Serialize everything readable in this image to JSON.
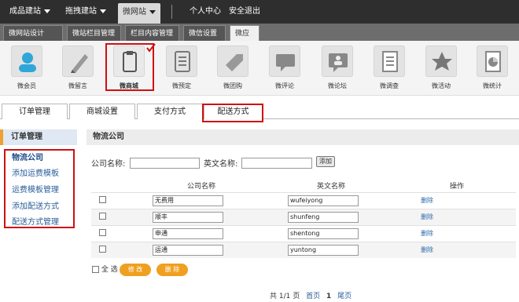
{
  "topnav": {
    "items": [
      "成品建站",
      "拖拽建站",
      "微网站"
    ],
    "right": [
      "个人中心",
      "安全退出"
    ]
  },
  "subtabs": [
    "微网站设计",
    "微站栏目管理",
    "栏目内容管理",
    "微信设置",
    "微应用"
  ],
  "apps": [
    "微会员",
    "微留言",
    "微商城",
    "微预定",
    "微团购",
    "微评论",
    "微论坛",
    "微调查",
    "微活动",
    "微统计"
  ],
  "maintabs": [
    "订单管理",
    "商城设置",
    "支付方式",
    "配送方式"
  ],
  "sidebar": {
    "title": "订单管理",
    "links": [
      "物流公司",
      "添加运费模板",
      "运费模板管理",
      "添加配送方式",
      "配送方式管理"
    ]
  },
  "panel": {
    "title": "物流公司",
    "company_label": "公司名称:",
    "english_label": "英文名称:",
    "add_button": "添加"
  },
  "table": {
    "headers": [
      "公司名称",
      "英文名称",
      "操作"
    ],
    "rows": [
      {
        "cn": "无费用",
        "en": "wufeiyong",
        "op": "删除"
      },
      {
        "cn": "顺丰",
        "en": "shunfeng",
        "op": "删除"
      },
      {
        "cn": "申通",
        "en": "shentong",
        "op": "删除"
      },
      {
        "cn": "运通",
        "en": "yuntong",
        "op": "删除"
      }
    ]
  },
  "bulk": {
    "select_all": "全 选",
    "edit": "修 改",
    "delete": "删 除"
  },
  "pager": {
    "info": "共 1/1 页",
    "first": "首页",
    "current": "1",
    "last": "尾页"
  }
}
